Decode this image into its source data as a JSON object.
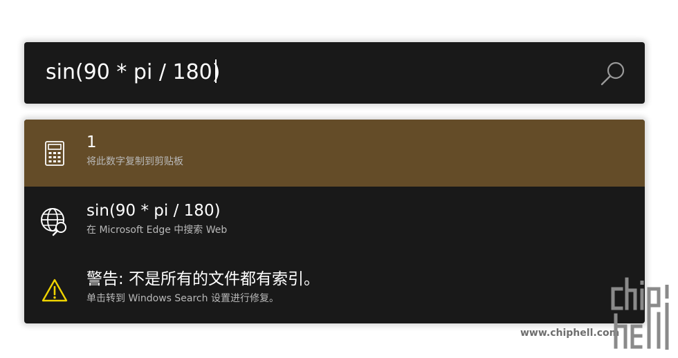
{
  "search": {
    "query": "sin(90 * pi / 180)",
    "button_icon": "search-icon"
  },
  "results": [
    {
      "icon": "calculator-icon",
      "title": "1",
      "subtitle": "将此数字复制到剪贴板",
      "selected": true
    },
    {
      "icon": "globe-search-icon",
      "title": "sin(90 * pi / 180)",
      "subtitle": "在 Microsoft Edge 中搜索 Web",
      "selected": false
    },
    {
      "icon": "warning-icon",
      "title": "警告: 不是所有的文件都有索引。",
      "subtitle": "单击转到 Windows Search 设置进行修复。",
      "selected": false
    }
  ],
  "watermark": {
    "url": "www.chiphell.com",
    "logo": "chiphell-logo"
  },
  "colors": {
    "panel_bg": "#191919",
    "selected_bg": "#644c28",
    "subtitle_text": "#b9b9b9",
    "warning_yellow": "#f0d400"
  }
}
